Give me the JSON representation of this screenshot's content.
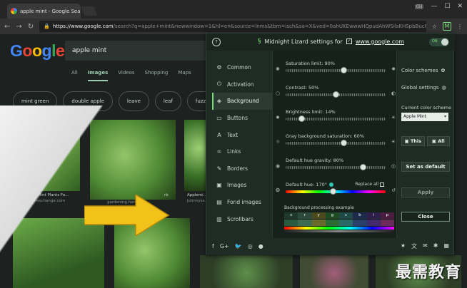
{
  "browser": {
    "tab_title": "apple mint - Google Sear",
    "url_scheme": "https://",
    "url_host": "www.google.com",
    "url_rest": "/search?q=apple+mint&newwindow=1&hl=en&source=lnms&tbm=isch&sa=X&ved=0ahUKEwwwHQpudAhWSilsKHSpbBucQ_A",
    "profile_badge": "(5)",
    "ext_ml": "M"
  },
  "google": {
    "logo": [
      "G",
      "o",
      "o",
      "g",
      "l",
      "e"
    ],
    "query": "apple mint",
    "tabs": [
      "All",
      "Images",
      "Videos",
      "Shopping",
      "Maps"
    ],
    "chips": [
      "mint green",
      "double apple",
      "leave",
      "leaf",
      "fuzzy"
    ],
    "captions": [
      {
        "title": "Mint - Apple Mint Plants Fo...",
        "source": "thegrowers-exchange.com"
      },
      {
        "title": "gardening-herbs",
        "source": ""
      },
      {
        "title": "rb",
        "source": ""
      },
      {
        "title": "Applemi...",
        "source": "johnnyse..."
      }
    ]
  },
  "ml": {
    "title": "Midnight Lizard settings for",
    "site": "www.google.com",
    "toggle": "ON",
    "nav": [
      {
        "label": "Common",
        "icon": "gear-icon"
      },
      {
        "label": "Activation",
        "icon": "power-icon"
      },
      {
        "label": "Background",
        "icon": "paint-bucket-icon"
      },
      {
        "label": "Buttons",
        "icon": "button-icon"
      },
      {
        "label": "Text",
        "icon": "text-icon"
      },
      {
        "label": "Links",
        "icon": "link-icon"
      },
      {
        "label": "Borders",
        "icon": "pencil-icon"
      },
      {
        "label": "Images",
        "icon": "image-icon"
      },
      {
        "label": "Fond images",
        "icon": "images-icon"
      },
      {
        "label": "Scrollbars",
        "icon": "scrollbar-icon"
      }
    ],
    "sliders": [
      {
        "label": "Saturation limit: 90%",
        "value": 0.58
      },
      {
        "label": "Contrast: 50%",
        "value": 0.5
      },
      {
        "label": "Brightness limit: 14%",
        "value": 0.16
      },
      {
        "label": "Gray background saturation: 60%",
        "value": 0.58
      },
      {
        "label": "Default hue gravity: 80%",
        "value": 0.77
      },
      {
        "label": "Default hue: 170°",
        "value": 0.47
      }
    ],
    "replace_all": "Replace all",
    "bpe_label": "Background processing example",
    "bpe_letters": [
      "s",
      "r",
      "y",
      "g",
      "c",
      "b",
      "i",
      "p"
    ],
    "right": {
      "color_schemes": "Color schemes",
      "global_settings": "Global settings",
      "current_scheme_label": "Current color scheme",
      "current_scheme": "Apple Mint",
      "this": "This",
      "all": "All",
      "set_default": "Set as default",
      "apply": "Apply",
      "close": "Close"
    }
  },
  "watermark": "最需教育"
}
